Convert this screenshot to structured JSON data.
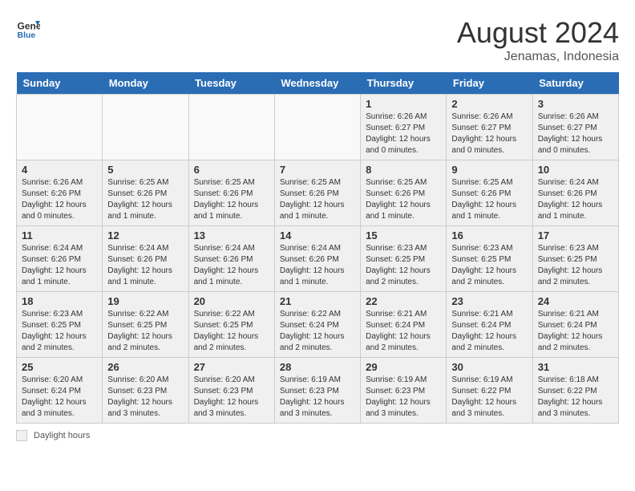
{
  "header": {
    "logo_line1": "General",
    "logo_line2": "Blue",
    "month_title": "August 2024",
    "location": "Jenamas, Indonesia"
  },
  "days_of_week": [
    "Sunday",
    "Monday",
    "Tuesday",
    "Wednesday",
    "Thursday",
    "Friday",
    "Saturday"
  ],
  "weeks": [
    [
      {
        "day": "",
        "info": ""
      },
      {
        "day": "",
        "info": ""
      },
      {
        "day": "",
        "info": ""
      },
      {
        "day": "",
        "info": ""
      },
      {
        "day": "1",
        "info": "Sunrise: 6:26 AM\nSunset: 6:27 PM\nDaylight: 12 hours\nand 0 minutes."
      },
      {
        "day": "2",
        "info": "Sunrise: 6:26 AM\nSunset: 6:27 PM\nDaylight: 12 hours\nand 0 minutes."
      },
      {
        "day": "3",
        "info": "Sunrise: 6:26 AM\nSunset: 6:27 PM\nDaylight: 12 hours\nand 0 minutes."
      }
    ],
    [
      {
        "day": "4",
        "info": "Sunrise: 6:26 AM\nSunset: 6:26 PM\nDaylight: 12 hours\nand 0 minutes."
      },
      {
        "day": "5",
        "info": "Sunrise: 6:25 AM\nSunset: 6:26 PM\nDaylight: 12 hours\nand 1 minute."
      },
      {
        "day": "6",
        "info": "Sunrise: 6:25 AM\nSunset: 6:26 PM\nDaylight: 12 hours\nand 1 minute."
      },
      {
        "day": "7",
        "info": "Sunrise: 6:25 AM\nSunset: 6:26 PM\nDaylight: 12 hours\nand 1 minute."
      },
      {
        "day": "8",
        "info": "Sunrise: 6:25 AM\nSunset: 6:26 PM\nDaylight: 12 hours\nand 1 minute."
      },
      {
        "day": "9",
        "info": "Sunrise: 6:25 AM\nSunset: 6:26 PM\nDaylight: 12 hours\nand 1 minute."
      },
      {
        "day": "10",
        "info": "Sunrise: 6:24 AM\nSunset: 6:26 PM\nDaylight: 12 hours\nand 1 minute."
      }
    ],
    [
      {
        "day": "11",
        "info": "Sunrise: 6:24 AM\nSunset: 6:26 PM\nDaylight: 12 hours\nand 1 minute."
      },
      {
        "day": "12",
        "info": "Sunrise: 6:24 AM\nSunset: 6:26 PM\nDaylight: 12 hours\nand 1 minute."
      },
      {
        "day": "13",
        "info": "Sunrise: 6:24 AM\nSunset: 6:26 PM\nDaylight: 12 hours\nand 1 minute."
      },
      {
        "day": "14",
        "info": "Sunrise: 6:24 AM\nSunset: 6:26 PM\nDaylight: 12 hours\nand 1 minute."
      },
      {
        "day": "15",
        "info": "Sunrise: 6:23 AM\nSunset: 6:25 PM\nDaylight: 12 hours\nand 2 minutes."
      },
      {
        "day": "16",
        "info": "Sunrise: 6:23 AM\nSunset: 6:25 PM\nDaylight: 12 hours\nand 2 minutes."
      },
      {
        "day": "17",
        "info": "Sunrise: 6:23 AM\nSunset: 6:25 PM\nDaylight: 12 hours\nand 2 minutes."
      }
    ],
    [
      {
        "day": "18",
        "info": "Sunrise: 6:23 AM\nSunset: 6:25 PM\nDaylight: 12 hours\nand 2 minutes."
      },
      {
        "day": "19",
        "info": "Sunrise: 6:22 AM\nSunset: 6:25 PM\nDaylight: 12 hours\nand 2 minutes."
      },
      {
        "day": "20",
        "info": "Sunrise: 6:22 AM\nSunset: 6:25 PM\nDaylight: 12 hours\nand 2 minutes."
      },
      {
        "day": "21",
        "info": "Sunrise: 6:22 AM\nSunset: 6:24 PM\nDaylight: 12 hours\nand 2 minutes."
      },
      {
        "day": "22",
        "info": "Sunrise: 6:21 AM\nSunset: 6:24 PM\nDaylight: 12 hours\nand 2 minutes."
      },
      {
        "day": "23",
        "info": "Sunrise: 6:21 AM\nSunset: 6:24 PM\nDaylight: 12 hours\nand 2 minutes."
      },
      {
        "day": "24",
        "info": "Sunrise: 6:21 AM\nSunset: 6:24 PM\nDaylight: 12 hours\nand 2 minutes."
      }
    ],
    [
      {
        "day": "25",
        "info": "Sunrise: 6:20 AM\nSunset: 6:24 PM\nDaylight: 12 hours\nand 3 minutes."
      },
      {
        "day": "26",
        "info": "Sunrise: 6:20 AM\nSunset: 6:23 PM\nDaylight: 12 hours\nand 3 minutes."
      },
      {
        "day": "27",
        "info": "Sunrise: 6:20 AM\nSunset: 6:23 PM\nDaylight: 12 hours\nand 3 minutes."
      },
      {
        "day": "28",
        "info": "Sunrise: 6:19 AM\nSunset: 6:23 PM\nDaylight: 12 hours\nand 3 minutes."
      },
      {
        "day": "29",
        "info": "Sunrise: 6:19 AM\nSunset: 6:23 PM\nDaylight: 12 hours\nand 3 minutes."
      },
      {
        "day": "30",
        "info": "Sunrise: 6:19 AM\nSunset: 6:22 PM\nDaylight: 12 hours\nand 3 minutes."
      },
      {
        "day": "31",
        "info": "Sunrise: 6:18 AM\nSunset: 6:22 PM\nDaylight: 12 hours\nand 3 minutes."
      }
    ]
  ],
  "footer": {
    "shaded_label": "Daylight hours"
  }
}
